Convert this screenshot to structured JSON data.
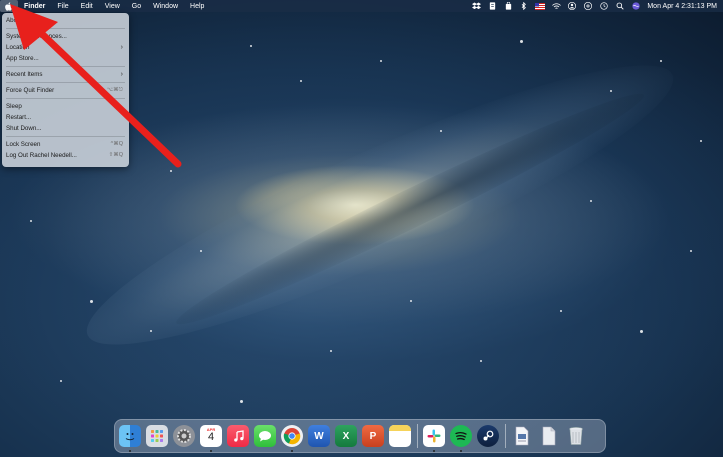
{
  "menubar": {
    "apple_icon": "apple-icon",
    "app_name": "Finder",
    "menus": [
      "File",
      "Edit",
      "View",
      "Go",
      "Window",
      "Help"
    ],
    "status_icons": [
      "dropbox-icon",
      "document-icon",
      "bag-icon",
      "bluetooth-icon",
      "us-flag-icon",
      "wifi-icon",
      "user-icon",
      "control-icon",
      "time-machine-icon",
      "search-icon",
      "siri-icon"
    ],
    "clock": "Mon Apr 4  2:31:13 PM"
  },
  "apple_menu": {
    "about": "About This Mac",
    "system_preferences": "System Preferences...",
    "location": "Location",
    "app_store": "App Store...",
    "recent_items": "Recent Items",
    "force_quit": "Force Quit Finder",
    "force_quit_shortcut": "⌥⌘⎋",
    "sleep": "Sleep",
    "restart": "Restart...",
    "shut_down": "Shut Down...",
    "lock_screen": "Lock Screen",
    "lock_screen_shortcut": "^⌘Q",
    "log_out": "Log Out Rachel Needell...",
    "log_out_shortcut": "⇧⌘Q"
  },
  "dock": {
    "calendar_month": "APR",
    "calendar_day": "4",
    "word_letter": "W",
    "excel_letter": "X",
    "powerpoint_letter": "P"
  },
  "colors": {
    "annotation_arrow": "#e8201c",
    "menubar_bg": "#1e3350",
    "dock_bg": "#c8d2e1"
  }
}
